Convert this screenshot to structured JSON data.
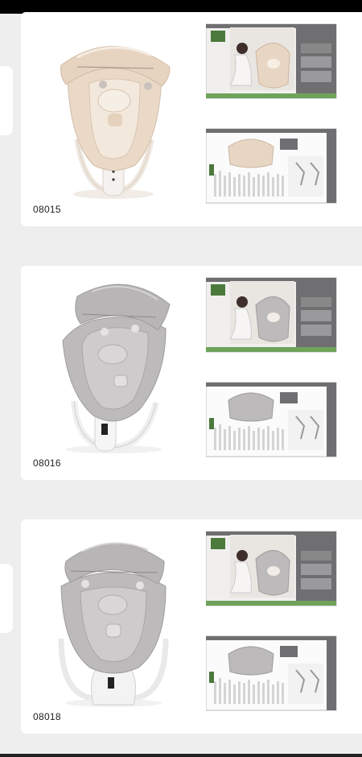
{
  "colors": {
    "background": "#eeeeee",
    "card": "#ffffff",
    "box_gray": "#6f6f72",
    "box_green": "#6fa35a",
    "beige": "#e8d6c4",
    "gray_fabric": "#bdbabb"
  },
  "products": [
    {
      "code": "08015",
      "color": "beige",
      "icon": "baby-swing-product-image"
    },
    {
      "code": "08016",
      "color": "gray",
      "icon": "baby-swing-product-image"
    },
    {
      "code": "08018",
      "color": "gray",
      "icon": "baby-swing-product-image"
    }
  ]
}
